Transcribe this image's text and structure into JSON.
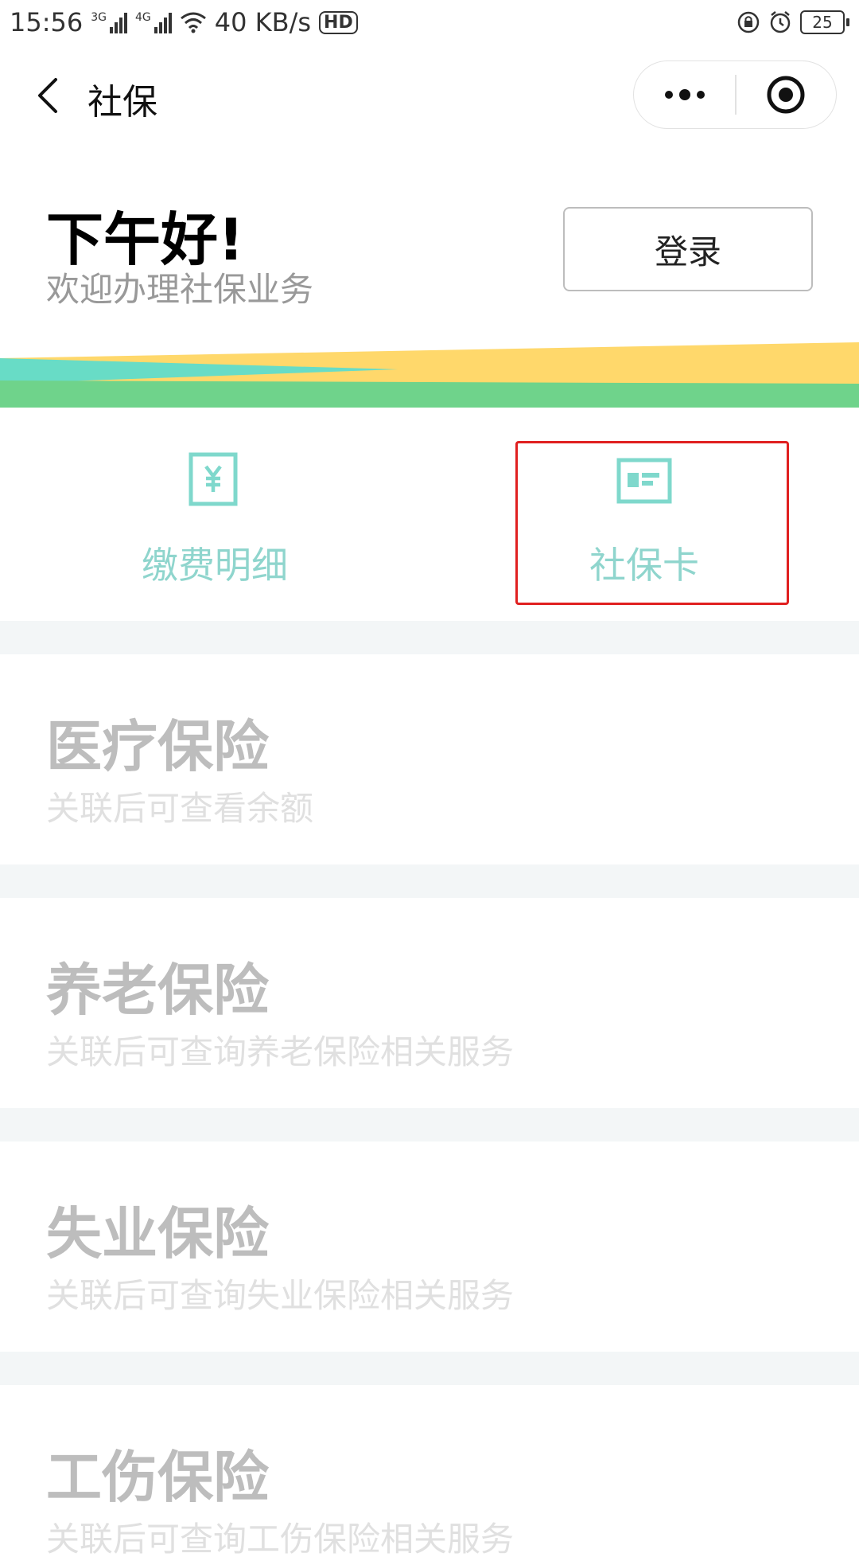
{
  "status_bar": {
    "time": "15:56",
    "signal1_label": "3G",
    "signal2_label": "4G",
    "network_speed": "40 KB/s",
    "hd_label": "HD",
    "battery": "25"
  },
  "nav": {
    "title": "社保"
  },
  "header": {
    "greeting": "下午好!",
    "subtitle": "欢迎办理社保业务",
    "login_label": "登录"
  },
  "quick_actions": [
    {
      "label": "缴费明细",
      "icon": "yuan-bill-icon"
    },
    {
      "label": "社保卡",
      "icon": "id-card-icon"
    }
  ],
  "cards": [
    {
      "title": "医疗保险",
      "desc": "关联后可查看余额"
    },
    {
      "title": "养老保险",
      "desc": "关联后可查询养老保险相关服务"
    },
    {
      "title": "失业保险",
      "desc": "关联后可查询失业保险相关服务"
    },
    {
      "title": "工伤保险",
      "desc": "关联后可查询工伤保险相关服务"
    }
  ],
  "colors": {
    "accent": "#7fd8cc",
    "band_teal": "#68dcc6",
    "band_yellow": "#ffd86b",
    "band_green": "#6fd38b",
    "highlight": "#e02020"
  }
}
